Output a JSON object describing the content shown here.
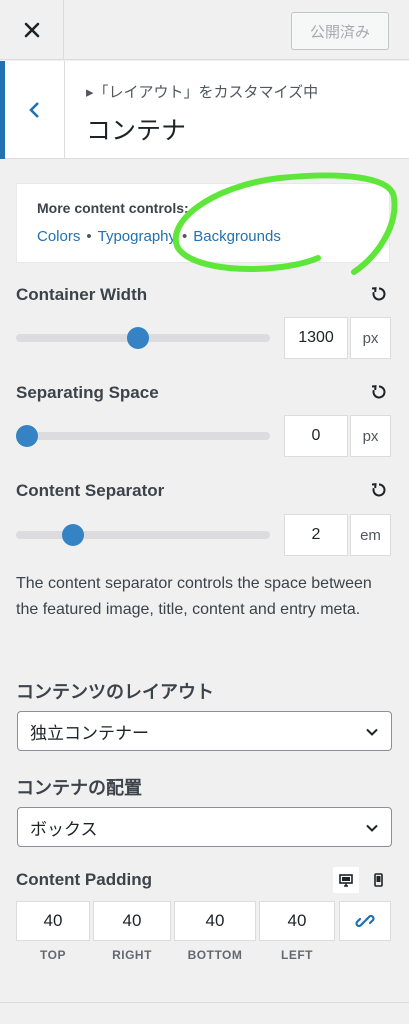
{
  "header": {
    "publish_label": "公開済み",
    "breadcrumb": "▸「レイアウト」をカスタマイズ中",
    "section_title": "コンテナ"
  },
  "more_controls": {
    "title": "More content controls:",
    "links": [
      "Colors",
      "Typography",
      "Backgrounds"
    ],
    "annotation_color": "#5ee73a"
  },
  "container_width": {
    "label": "Container Width",
    "value": "1300",
    "unit": "px",
    "slider_fraction": 0.48
  },
  "separating_space": {
    "label": "Separating Space",
    "value": "0",
    "unit": "px",
    "slider_fraction": 0.0
  },
  "content_separator": {
    "label": "Content Separator",
    "value": "2",
    "unit": "em",
    "slider_fraction": 0.2
  },
  "description": "The content separator controls the space between the featured image, title, content and entry meta.",
  "content_layout": {
    "label": "コンテンツのレイアウト",
    "selected": "独立コンテナー"
  },
  "container_placement": {
    "label": "コンテナの配置",
    "selected": "ボックス"
  },
  "content_padding": {
    "label": "Content Padding",
    "fields": [
      {
        "caption": "TOP",
        "value": "40"
      },
      {
        "caption": "RIGHT",
        "value": "40"
      },
      {
        "caption": "BOTTOM",
        "value": "40"
      },
      {
        "caption": "LEFT",
        "value": "40"
      }
    ]
  },
  "colors": {
    "accent": "#2271b1",
    "slider_thumb": "#3582c4"
  }
}
